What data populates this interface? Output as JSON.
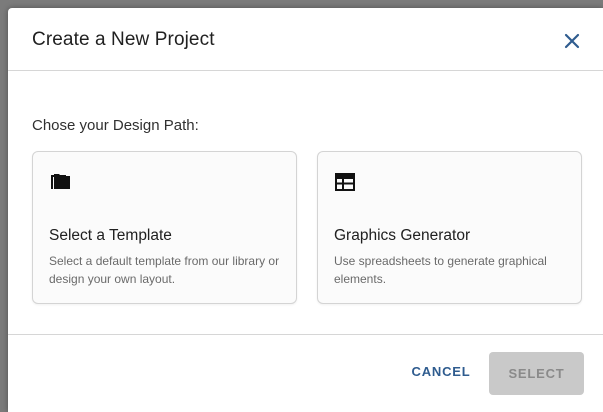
{
  "dialog": {
    "title": "Create a New Project",
    "close_icon": "close-icon"
  },
  "body": {
    "prompt": "Chose your Design Path:",
    "cards": [
      {
        "icon": "folder-icon",
        "title": "Select a Template",
        "description": "Select a default template from our library or design your own layout."
      },
      {
        "icon": "table-layout-icon",
        "title": "Graphics Generator",
        "description": "Use spreadsheets to generate graphical elements."
      }
    ]
  },
  "footer": {
    "cancel_label": "CANCEL",
    "select_label": "SELECT",
    "select_disabled": true
  },
  "colors": {
    "accent": "#2f5c8f",
    "disabled_bg": "#c9c9c9",
    "overlay": "#7b7b7b"
  }
}
